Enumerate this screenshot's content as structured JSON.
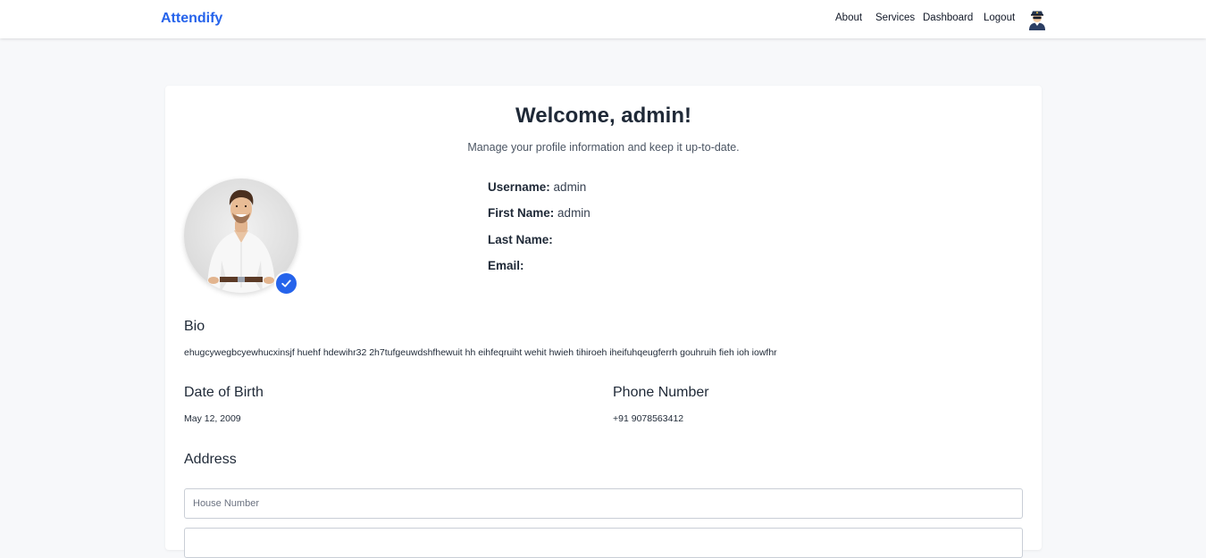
{
  "navbar": {
    "brand": "Attendify",
    "links": [
      "About",
      "Services",
      "Dashboard",
      "Logout"
    ],
    "avatar_icon": "user-avatar-icon"
  },
  "profile": {
    "title": "Welcome, admin!",
    "subtitle": "Manage your profile information and keep it up-to-date.",
    "verified_icon": "check-icon",
    "fields": [
      {
        "label": "Username:",
        "value": "admin"
      },
      {
        "label": "First Name:",
        "value": "admin"
      },
      {
        "label": "Last Name:",
        "value": ""
      },
      {
        "label": "Email:",
        "value": ""
      }
    ],
    "bio_heading": "Bio",
    "bio_text": "ehugcywegbcyewhucxinsjf huehf hdewihr32 2h7tufgeuwdshfhewuit hh eihfeqruiht wehit hwieh tihiroeh iheifuhqeugferrh gouhruih fieh ioh iowfhr",
    "dob_heading": "Date of Birth",
    "dob_value": "May 12, 2009",
    "phone_heading": "Phone Number",
    "phone_value": "+91 9078563412",
    "address_heading": "Address",
    "house_number_placeholder": "House Number",
    "house_number_value": ""
  },
  "colors": {
    "accent": "#2563eb",
    "background": "#f7f8fa",
    "card": "#ffffff",
    "text": "#1f2937"
  }
}
